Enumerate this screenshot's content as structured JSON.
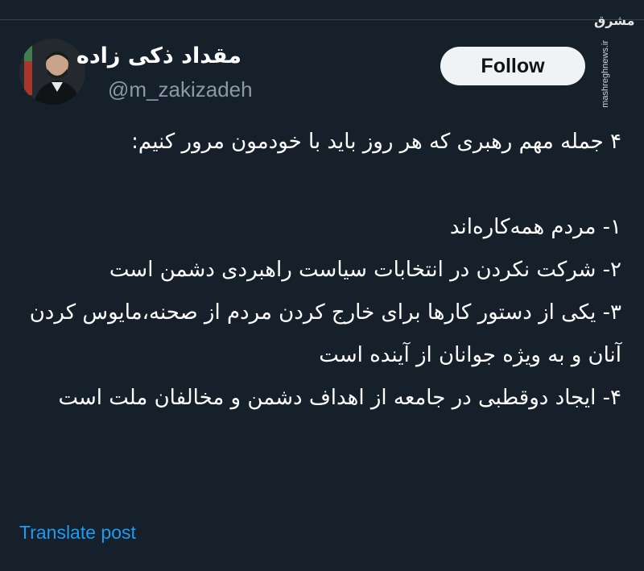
{
  "author": {
    "display_name": "مقداد ذکی زاده",
    "handle": "@m_zakizadeh"
  },
  "follow_button": {
    "label": "Follow"
  },
  "watermark": {
    "logo_text": "مشرق",
    "url": "mashreghnews.ir"
  },
  "tweet": {
    "lines": [
      "۴ جمله مهم رهبری که هر روز باید با خودمون مرور کنیم:",
      "",
      "۱- مردم همه‌کاره‌اند",
      "۲- شرکت نکردن در انتخابات سیاست راهبردی دشمن است",
      "۳- یکی از دستور کارها برای خارج کردن مردم از صحنه،مایوس کردن آنان و به ویژه جوانان از آینده است",
      "۴- ایجاد دوقطبی در جامعه از اهداف دشمن و مخالفان ملت است"
    ]
  },
  "translate_link": {
    "label": "Translate post"
  },
  "colors": {
    "background": "#15202b",
    "text": "#ffffff",
    "secondary_text": "#8b98a5",
    "link": "#1d9bf0",
    "button_bg": "#eff3f4",
    "button_text": "#0f1419"
  }
}
